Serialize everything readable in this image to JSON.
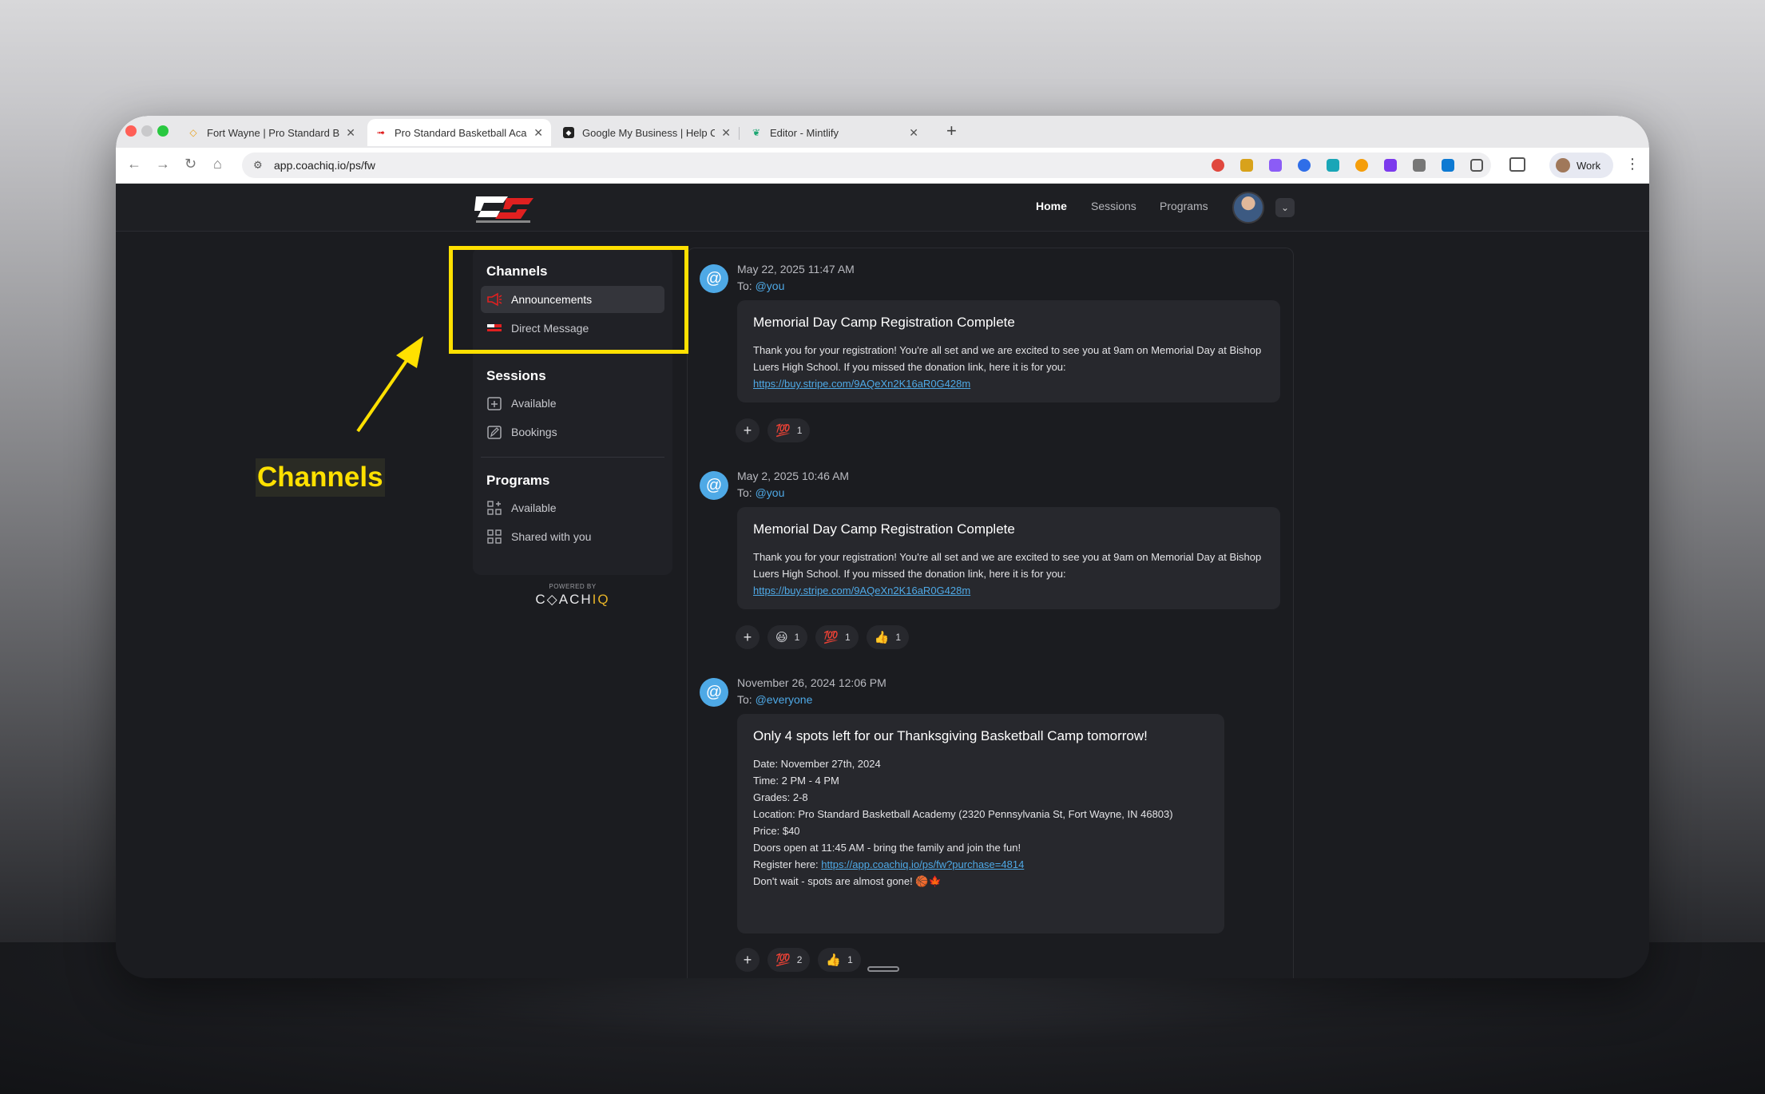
{
  "browser": {
    "tabs": [
      {
        "title": "Fort Wayne | Pro Standard Ba",
        "active": false
      },
      {
        "title": "Pro Standard Basketball Acad",
        "active": true
      },
      {
        "title": "Google My Business | Help C",
        "active": false
      },
      {
        "title": "Editor - Mintlify",
        "active": false
      }
    ],
    "new_tab": "+",
    "url": "app.coachiq.io/ps/fw",
    "profile_label": "Work"
  },
  "header": {
    "nav": [
      "Home",
      "Sessions",
      "Programs"
    ],
    "dropdown_glyph": "⌄"
  },
  "sidebar": {
    "channels_heading": "Channels",
    "channels": [
      "Announcements",
      "Direct Message"
    ],
    "sessions_heading": "Sessions",
    "sessions": [
      "Available",
      "Bookings"
    ],
    "programs_heading": "Programs",
    "programs": [
      "Available",
      "Shared with you"
    ],
    "powered_by": "POWERED BY",
    "brand_main": "C◇ACH",
    "brand_accent": "IQ"
  },
  "messages": [
    {
      "date": "May 22, 2025 11:47 AM",
      "to_prefix": "To: ",
      "to": "@you",
      "title": "Memorial Day Camp Registration Complete",
      "body": "Thank you for your registration! You're all set and we are excited to see you at 9am on Memorial Day at Bishop Luers High School. If you missed the donation link, here it is for you:",
      "link": "https://buy.stripe.com/9AQeXn2K16aR0G428m",
      "reactions": [
        {
          "emoji": "💯",
          "count": "1"
        }
      ]
    },
    {
      "date": "May 2, 2025 10:46 AM",
      "to_prefix": "To: ",
      "to": "@you",
      "title": "Memorial Day Camp Registration Complete",
      "body": "Thank you for your registration! You're all set and we are excited to see you at 9am on Memorial Day at Bishop Luers High School. If you missed the donation link, here it is for you:",
      "link": "https://buy.stripe.com/9AQeXn2K16aR0G428m",
      "reactions": [
        {
          "emoji": "😃",
          "count": "1"
        },
        {
          "emoji": "💯",
          "count": "1"
        },
        {
          "emoji": "👍",
          "count": "1"
        }
      ]
    },
    {
      "date": "November 26, 2024 12:06 PM",
      "to_prefix": "To: ",
      "to": "@everyone",
      "title": "Only 4 spots left for our Thanksgiving Basketball Camp tomorrow!",
      "lines": [
        "Date: November 27th, 2024",
        "Time: 2 PM - 4 PM",
        "Grades: 2-8",
        "Location: Pro Standard Basketball Academy (2320 Pennsylvania St, Fort Wayne, IN 46803)",
        "Price: $40",
        "Doors open at 11:45 AM - bring the family and join the fun!"
      ],
      "register_prefix": "Register here: ",
      "register_link": "https://app.coachiq.io/ps/fw?purchase=4814",
      "closing": "Don't wait - spots are almost gone! 🏀🍁",
      "reactions": [
        {
          "emoji": "💯",
          "count": "2"
        },
        {
          "emoji": "👍",
          "count": "1"
        }
      ]
    }
  ],
  "add_reaction": "+",
  "annotation": {
    "label": "Channels",
    "color": "#ffe000"
  }
}
